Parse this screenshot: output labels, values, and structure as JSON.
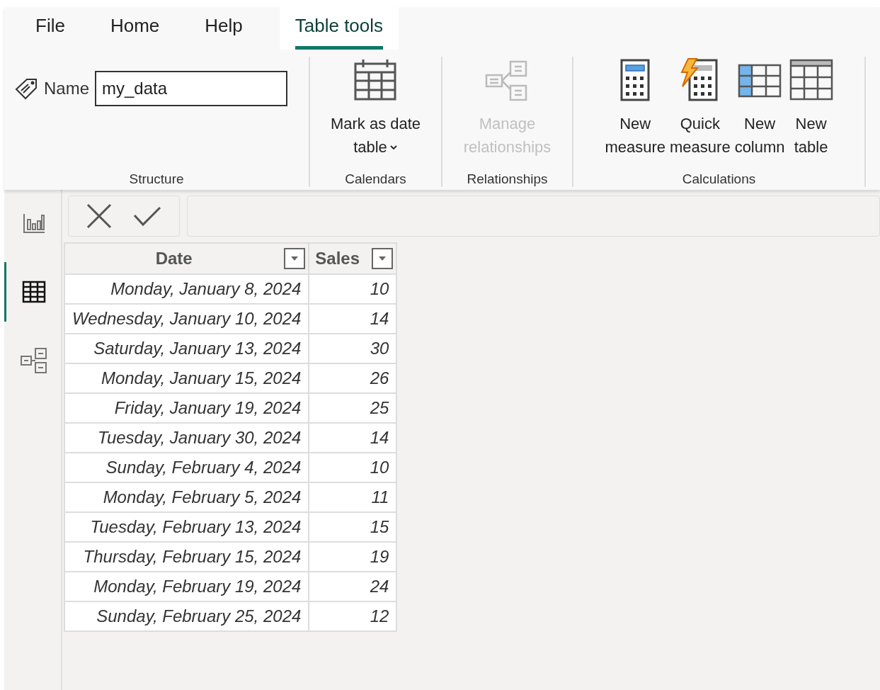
{
  "tabs": [
    {
      "label": "File",
      "selected": false
    },
    {
      "label": "Home",
      "selected": false
    },
    {
      "label": "Help",
      "selected": false
    },
    {
      "label": "Table tools",
      "selected": true
    }
  ],
  "ribbon_groups": [
    {
      "label": "Structure",
      "kind": "name",
      "name_label": "Name",
      "name_value": "my_data"
    },
    {
      "label": "Calendars",
      "kind": "buttons",
      "buttons": [
        {
          "kind": "calendar",
          "lines": [
            "Mark as date",
            "table"
          ],
          "dropdown": true,
          "disabled": false
        }
      ]
    },
    {
      "label": "Relationships",
      "kind": "buttons",
      "buttons": [
        {
          "kind": "relationships",
          "lines": [
            "Manage",
            "relationships"
          ],
          "dropdown": false,
          "disabled": true
        }
      ]
    },
    {
      "label": "Calculations",
      "kind": "buttons",
      "buttons": [
        {
          "kind": "measure",
          "lines": [
            "New",
            "measure"
          ],
          "dropdown": false,
          "disabled": false
        },
        {
          "kind": "quick-measure",
          "lines": [
            "Quick",
            "measure"
          ],
          "dropdown": false,
          "disabled": false
        },
        {
          "kind": "column",
          "lines": [
            "New",
            "column"
          ],
          "dropdown": false,
          "disabled": false
        },
        {
          "kind": "table",
          "lines": [
            "New",
            "table"
          ],
          "dropdown": false,
          "disabled": false
        }
      ]
    }
  ],
  "side_rail": [
    {
      "kind": "report",
      "selected": false
    },
    {
      "kind": "data",
      "selected": true
    },
    {
      "kind": "model",
      "selected": false
    }
  ],
  "table": {
    "columns": [
      "Date",
      "Sales"
    ],
    "rows": [
      [
        "Monday, January 8, 2024",
        "10"
      ],
      [
        "Wednesday, January 10, 2024",
        "14"
      ],
      [
        "Saturday, January 13, 2024",
        "30"
      ],
      [
        "Monday, January 15, 2024",
        "26"
      ],
      [
        "Friday, January 19, 2024",
        "25"
      ],
      [
        "Tuesday, January 30, 2024",
        "14"
      ],
      [
        "Sunday, February 4, 2024",
        "10"
      ],
      [
        "Monday, February 5, 2024",
        "11"
      ],
      [
        "Tuesday, February 13, 2024",
        "15"
      ],
      [
        "Thursday, February 15, 2024",
        "19"
      ],
      [
        "Monday, February 19, 2024",
        "24"
      ],
      [
        "Sunday, February 25, 2024",
        "12"
      ]
    ]
  }
}
